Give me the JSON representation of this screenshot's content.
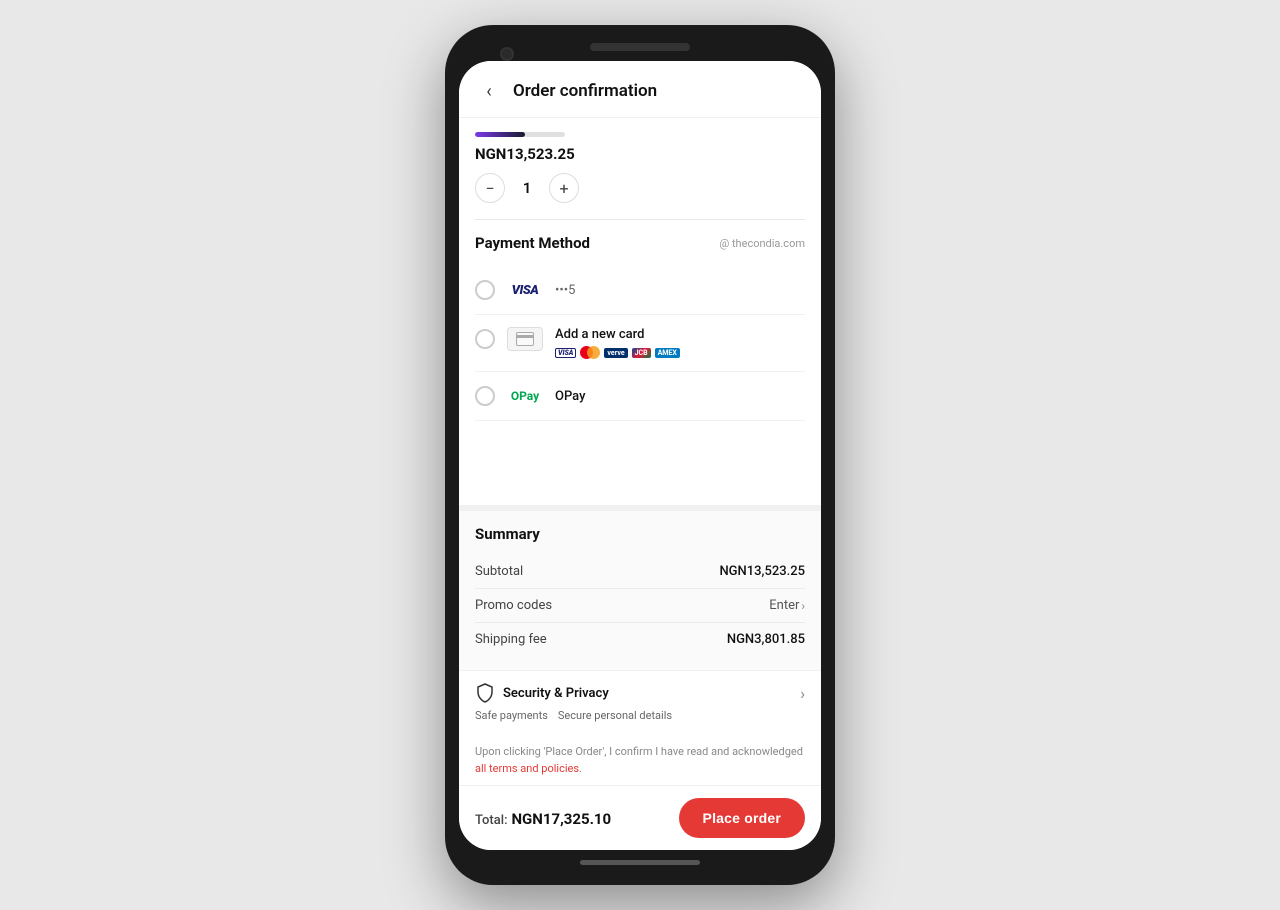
{
  "header": {
    "title": "Order confirmation",
    "back_label": "‹"
  },
  "progress": {
    "fill_percent": 55
  },
  "price": {
    "display": "NGN13,523.25"
  },
  "quantity": {
    "value": "1",
    "minus_label": "−",
    "plus_label": "+"
  },
  "payment_method": {
    "section_title": "Payment Method",
    "website": "@ thecondia.com",
    "options": [
      {
        "id": "visa",
        "type": "visa",
        "label": "VISA",
        "card_partial": "•••5",
        "selected": false
      },
      {
        "id": "new_card",
        "type": "new_card",
        "label": "Add a new card",
        "selected": false
      },
      {
        "id": "opay",
        "type": "opay",
        "label": "OPay",
        "selected": false
      }
    ]
  },
  "summary": {
    "section_title": "Summary",
    "rows": [
      {
        "label": "Subtotal",
        "value": "NGN13,523.25"
      },
      {
        "label": "Promo codes",
        "value": "Enter",
        "is_link": true
      },
      {
        "label": "Shipping fee",
        "value": "NGN3,801.85"
      }
    ]
  },
  "security": {
    "title": "Security & Privacy",
    "tags": [
      "Safe payments",
      "Secure personal details"
    ],
    "chevron": "›"
  },
  "consent": {
    "text_before": "Upon clicking 'Place Order', I confirm I have read and acknowledged ",
    "link_text": "all terms and policies",
    "text_after": "."
  },
  "footer": {
    "total_label": "Total:",
    "total_amount": "NGN17,325.10",
    "place_order_label": "Place order"
  }
}
